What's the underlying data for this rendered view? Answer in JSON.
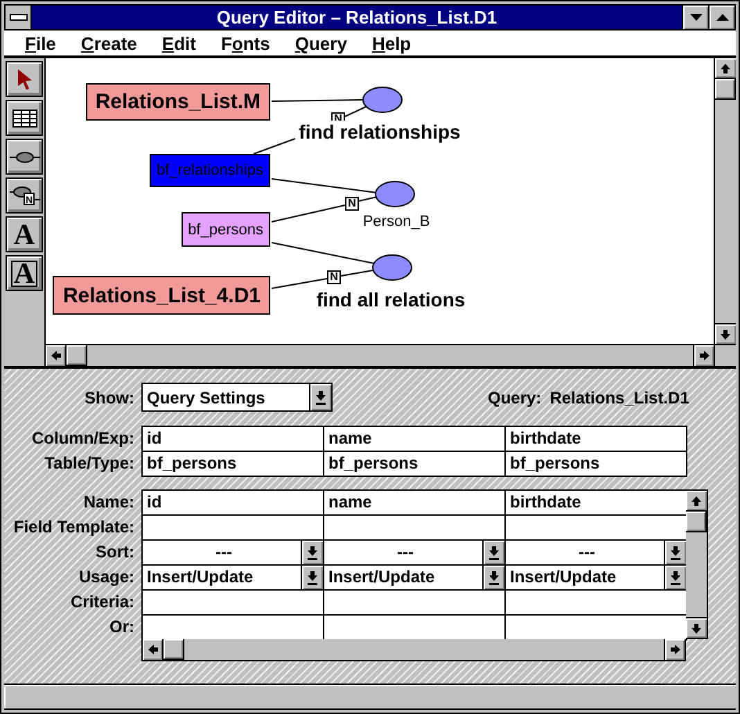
{
  "window": {
    "title": "Query Editor – Relations_List.D1"
  },
  "menu": [
    {
      "mnemonic": "F",
      "after": "ile"
    },
    {
      "mnemonic": "C",
      "after": "reate"
    },
    {
      "mnemonic": "E",
      "after": "dit"
    },
    {
      "before": "F",
      "mnemonic": "o",
      "after": "nts"
    },
    {
      "mnemonic": "Q",
      "after": "uery"
    },
    {
      "mnemonic": "H",
      "after": "elp"
    }
  ],
  "tools": [
    {
      "kind": "pointer"
    },
    {
      "kind": "table"
    },
    {
      "kind": "link"
    },
    {
      "kind": "link-n",
      "glyph": "N"
    },
    {
      "kind": "text",
      "glyph": "A"
    },
    {
      "kind": "framed-text",
      "glyph": "A"
    }
  ],
  "diagram": {
    "entities": [
      {
        "label": "Relations_List.M",
        "kind": "query",
        "selected": false
      },
      {
        "label": "bf_relationships",
        "kind": "table",
        "selected": true
      },
      {
        "label": "bf_persons",
        "kind": "table",
        "selected": false
      },
      {
        "label": "Relations_List_4.D1",
        "kind": "query",
        "selected": false
      }
    ],
    "relationships": [
      {
        "label": "find relationships",
        "kind": "query",
        "marker": "N"
      },
      {
        "label": "Person_B",
        "kind": "alias",
        "marker": "N"
      },
      {
        "label": "find all relations",
        "kind": "query",
        "marker": "N"
      }
    ]
  },
  "query_panel": {
    "show_label": "Show:",
    "show_value": "Query Settings",
    "query_label": "Query:",
    "query_name": "Relations_List.D1",
    "source_grid": [
      {
        "label": "Column/Exp:",
        "cells": [
          "id",
          "name",
          "birthdate"
        ]
      },
      {
        "label": "Table/Type:",
        "cells": [
          "bf_persons",
          "bf_persons",
          "bf_persons"
        ]
      }
    ],
    "field_grid": [
      {
        "label": "Name:",
        "kind": "text",
        "cells": [
          "id",
          "name",
          "birthdate"
        ]
      },
      {
        "label": "Field Template:",
        "kind": "blank"
      },
      {
        "label": "Sort:",
        "kind": "centered-choice",
        "cells": [
          "---",
          "---",
          "---"
        ]
      },
      {
        "label": "Usage:",
        "kind": "choice",
        "cells": [
          "Insert/Update",
          "Insert/Update",
          "Insert/Update"
        ]
      },
      {
        "label": "Criteria:",
        "kind": "blank"
      },
      {
        "label": "Or:",
        "kind": "blank"
      }
    ]
  }
}
